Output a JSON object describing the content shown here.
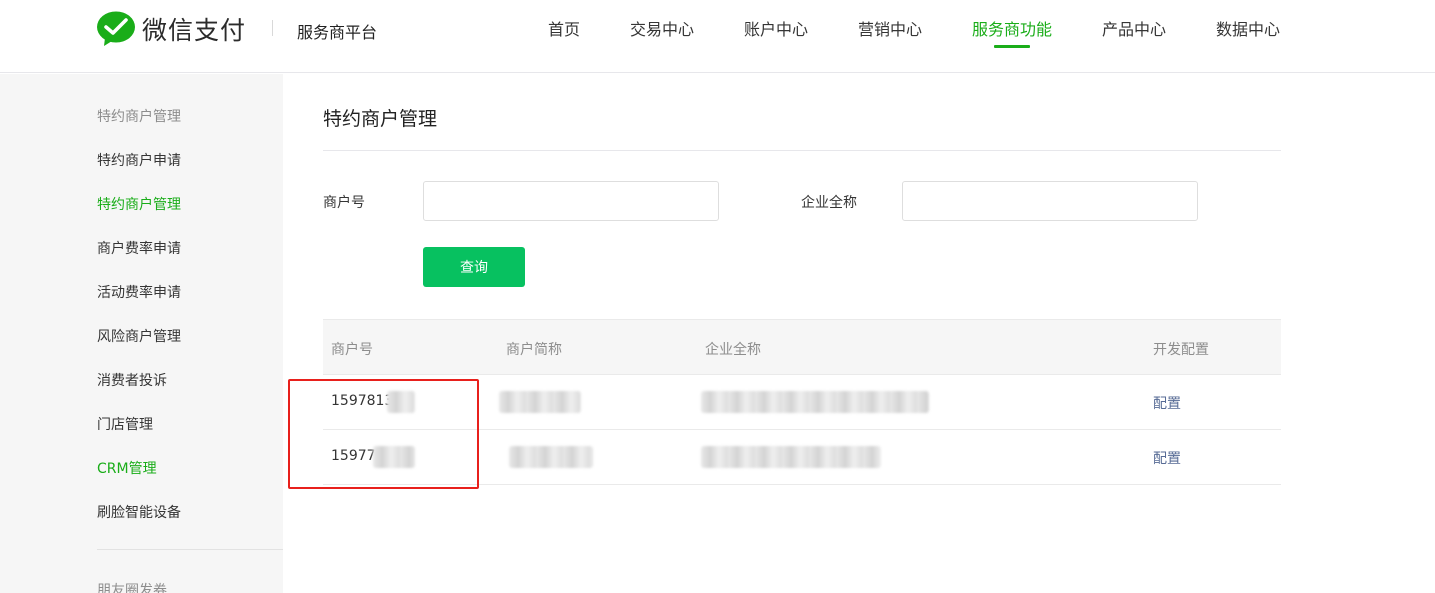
{
  "brand": {
    "logo_text": "微信支付",
    "platform_name": "服务商平台",
    "accent_color": "#1aad19",
    "button_color": "#07c160"
  },
  "topnav": {
    "items": [
      {
        "label": "首页"
      },
      {
        "label": "交易中心"
      },
      {
        "label": "账户中心"
      },
      {
        "label": "营销中心"
      },
      {
        "label": "服务商功能",
        "active": true
      },
      {
        "label": "产品中心"
      },
      {
        "label": "数据中心"
      }
    ]
  },
  "sidebar": {
    "group1_title": "特约商户管理",
    "items": [
      {
        "label": "特约商户申请"
      },
      {
        "label": "特约商户管理",
        "active": true
      },
      {
        "label": "商户费率申请"
      },
      {
        "label": "活动费率申请"
      },
      {
        "label": "风险商户管理"
      },
      {
        "label": "消费者投诉"
      },
      {
        "label": "门店管理"
      },
      {
        "label": "CRM管理",
        "active": true
      },
      {
        "label": "刷脸智能设备"
      }
    ],
    "group2_title": "朋友圈发券"
  },
  "main": {
    "page_title": "特约商户管理",
    "form": {
      "merchant_no_label": "商户号",
      "merchant_no_value": "",
      "company_name_label": "企业全称",
      "company_name_value": "",
      "query_button": "查询"
    },
    "table": {
      "headers": [
        "商户号",
        "商户简称",
        "企业全称",
        "开发配置"
      ],
      "rows": [
        {
          "merchant_no": "1597813",
          "config": "配置"
        },
        {
          "merchant_no": "15977",
          "config": "配置"
        }
      ]
    }
  }
}
